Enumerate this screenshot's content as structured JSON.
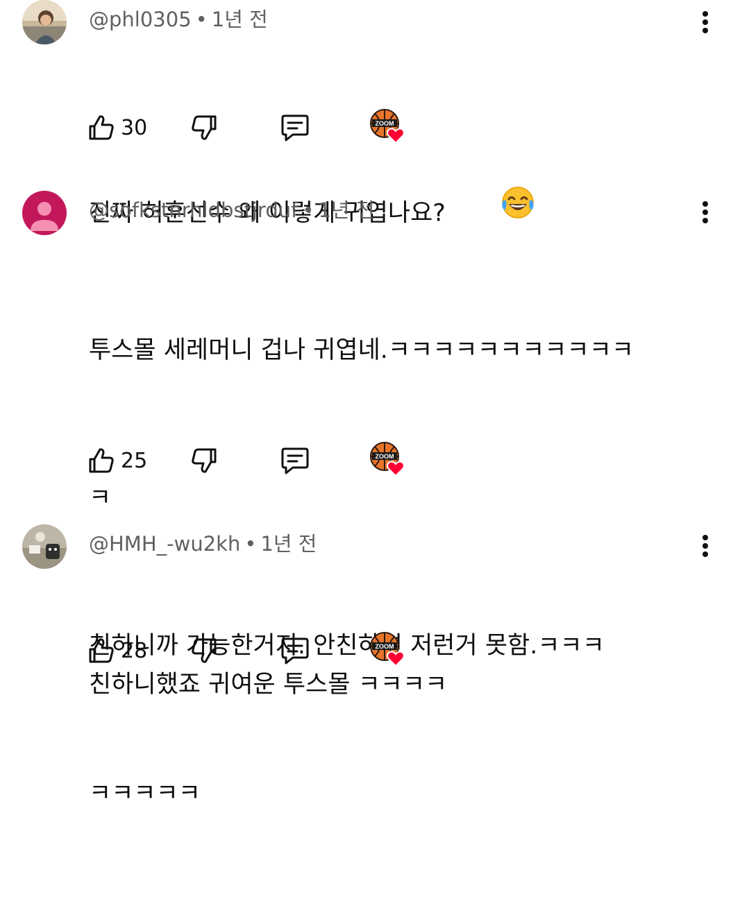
{
  "comments": [
    {
      "handle": "@phl0305",
      "separator": "•",
      "time": "1년 전",
      "lines": [
        "진짜 허훈선수 왜 이렇게 귀엽나요?"
      ],
      "emoji": "face-with-tears-of-joy",
      "likes": "30",
      "avatar": "photo-avatar"
    },
    {
      "handle": "@sofkstnrhldbstjrduf",
      "separator": "•",
      "time": "1년 전",
      "lines": [
        "투스몰 세레머니 겁나 귀엽네.ㅋㅋㅋㅋㅋㅋㅋㅋㅋㅋㅋ",
        "ㅋ",
        "친하니까 가능한거지. 안친하면 저런거 못함.ㅋㅋㅋ",
        "ㅋㅋㅋㅋㅋ"
      ],
      "likes": "25",
      "avatar": "default-person-avatar"
    },
    {
      "handle": "@HMH_-wu2kh",
      "separator": "•",
      "time": "1년 전",
      "lines": [
        "친하니했죠 귀여운 투스몰 ㅋㅋㅋㅋ"
      ],
      "likes": "28",
      "avatar": "photo-avatar"
    }
  ],
  "badge": {
    "text": "ZOOM",
    "icon": "creator-heart-basketball",
    "heart_color": "#ff0033",
    "ball_color": "#e8742a"
  },
  "colors": {
    "text": "#0f0f0f",
    "meta": "#606060",
    "default_avatar_bg": "#c2185b"
  }
}
